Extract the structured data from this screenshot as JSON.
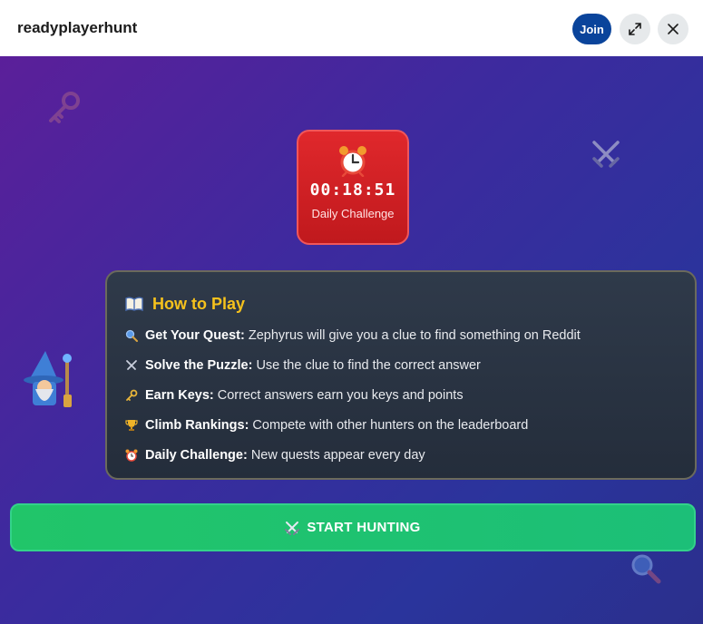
{
  "header": {
    "title": "readyplayerhunt",
    "join_label": "Join",
    "expand_icon": "expand-icon",
    "close_icon": "close-icon"
  },
  "timer": {
    "value": "00:18:51",
    "label": "Daily Challenge",
    "icon": "alarm-clock-icon"
  },
  "how_to_play": {
    "title": "How to Play",
    "title_icon": "open-book-icon",
    "rules": [
      {
        "icon": "magnifier-icon",
        "heading": "Get Your Quest:",
        "text": "Zephyrus will give you a clue to find something on Reddit"
      },
      {
        "icon": "crossed-swords-icon",
        "heading": "Solve the Puzzle:",
        "text": "Use the clue to find the correct answer"
      },
      {
        "icon": "key-icon",
        "heading": "Earn Keys:",
        "text": "Correct answers earn you keys and points"
      },
      {
        "icon": "trophy-icon",
        "heading": "Climb Rankings:",
        "text": "Compete with other hunters on the leaderboard"
      },
      {
        "icon": "alarm-clock-icon",
        "heading": "Daily Challenge:",
        "text": "New quests appear every day"
      }
    ]
  },
  "start_button": {
    "label": "START HUNTING",
    "icon": "crossed-swords-icon"
  },
  "colors": {
    "accent_gold": "#f6c21c",
    "timer_red": "#d62226",
    "start_green": "#21c569",
    "join_blue": "#0a449b"
  }
}
